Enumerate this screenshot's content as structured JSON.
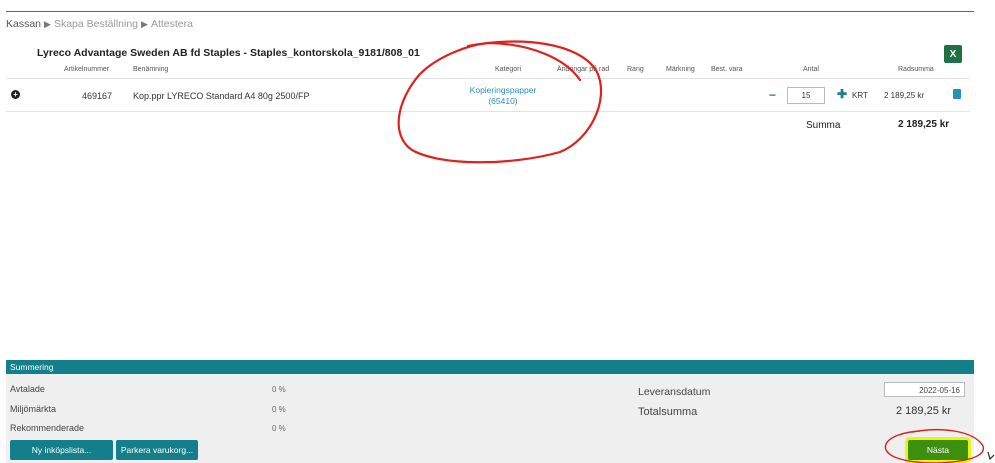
{
  "breadcrumb": {
    "items": [
      "Kassan",
      "Skapa Beställning",
      "Attestera"
    ]
  },
  "supplier": {
    "title": "Lyreco Advantage Sweden AB fd Staples - Staples_kontorskola_9181/808_01"
  },
  "table": {
    "headers": {
      "article": "Artikelnummer",
      "name": "Benämning",
      "category": "Kategori",
      "change": "Ändringar på rad",
      "rank": "Rang",
      "marking": "Märkning",
      "best": "Best. vara",
      "qty": "Antal",
      "rowsum": "Radsumma"
    },
    "rows": [
      {
        "article": "469167",
        "name": "Kop.ppr LYRECO Standard A4 80g 2500/FP",
        "category_line1": "Kopieringspapper",
        "category_line2": "(65410)",
        "quantity": "15",
        "unit": "KRT",
        "rowsum": "2 189,25 kr"
      }
    ],
    "sum_label": "Summa",
    "sum_value": "2 189,25 kr"
  },
  "summary": {
    "title": "Summering",
    "items": [
      {
        "label": "Avtalade",
        "value": "0 %"
      },
      {
        "label": "Miljömärkta",
        "value": "0 %"
      },
      {
        "label": "Rekommenderade",
        "value": "0 %"
      }
    ],
    "delivery_label": "Leveransdatum",
    "delivery_date": "2022-05-16",
    "total_label": "Totalsumma",
    "total_value": "2 189,25 kr"
  },
  "buttons": {
    "new_list": "Ny inköpslista...",
    "park": "Parkera varukorg...",
    "next": "Nästa"
  },
  "icons": {
    "excel": "excel-export-icon",
    "expand": "expand-row-icon",
    "trash": "delete-row-icon"
  },
  "colors": {
    "accent": "#127f8a",
    "link": "#2a8fbd",
    "next": "#3d8f0e",
    "highlight": "#e9f50d",
    "annotation": "#e0201c"
  }
}
